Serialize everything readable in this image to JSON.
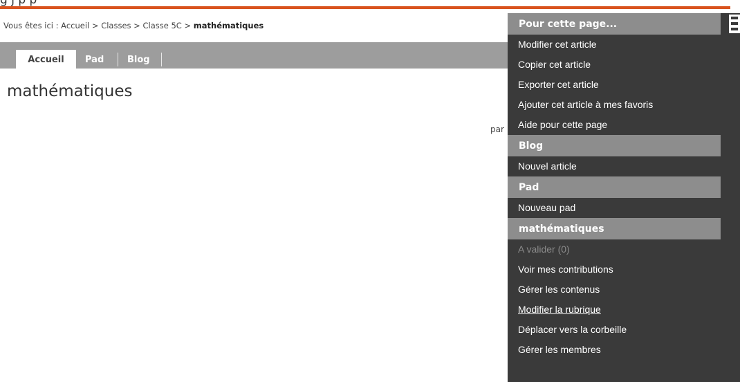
{
  "breadcrumb": {
    "prefix": "Vous êtes ici :",
    "items": [
      "Accueil",
      "Classes",
      "Classe 5C"
    ],
    "separator": ">",
    "current": "mathématiques"
  },
  "tabs": [
    "Accueil",
    "Pad",
    "Blog"
  ],
  "page_title": "mathématiques",
  "byline_fragment": "par",
  "side_menu": {
    "sections": [
      {
        "title": "Pour cette page...",
        "items": [
          {
            "label": "Modifier cet article"
          },
          {
            "label": "Copier cet article"
          },
          {
            "label": "Exporter cet article"
          },
          {
            "label": "Ajouter cet article à mes favoris"
          },
          {
            "label": "Aide pour cette page"
          }
        ]
      },
      {
        "title": "Blog",
        "items": [
          {
            "label": "Nouvel article"
          }
        ]
      },
      {
        "title": "Pad",
        "items": [
          {
            "label": "Nouveau pad"
          }
        ]
      },
      {
        "title": "mathématiques",
        "items": [
          {
            "label": "A valider (0)",
            "disabled": true
          },
          {
            "label": "Voir mes contributions"
          },
          {
            "label": "Gérer les contenus"
          },
          {
            "label": "Modifier la rubrique",
            "underlined": true
          },
          {
            "label": "Déplacer vers la corbeille"
          },
          {
            "label": "Gérer les membres"
          }
        ]
      }
    ]
  },
  "colors": {
    "accent": "#d9531e",
    "tabbar": "#9d9d9d",
    "menu_bg": "#3a3a3a",
    "menu_header": "#8d8d8d"
  }
}
